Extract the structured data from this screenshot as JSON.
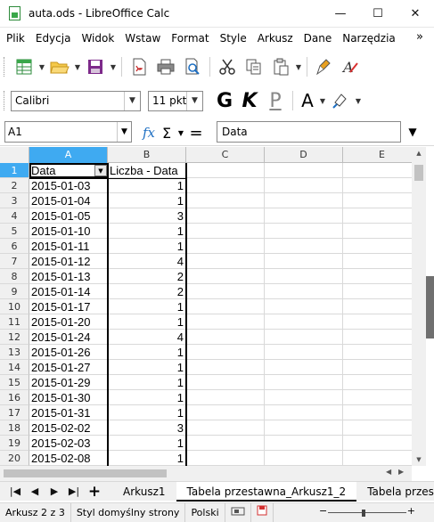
{
  "window": {
    "title": "auta.ods - LibreOffice Calc",
    "minimize": "—",
    "maximize": "☐",
    "close": "✕"
  },
  "menu": {
    "items": [
      "Plik",
      "Edycja",
      "Widok",
      "Wstaw",
      "Format",
      "Style",
      "Arkusz",
      "Dane",
      "Narzędzia"
    ],
    "more": "»"
  },
  "formatting": {
    "font_name": "Calibri",
    "font_size": "11 pkt",
    "bold": "G",
    "italic": "K",
    "underline": "P",
    "font_color": "A"
  },
  "formula_bar": {
    "name_box": "A1",
    "fx": "fx",
    "sum": "Σ",
    "equals": "=",
    "content": "Data"
  },
  "columns": [
    "A",
    "B",
    "C",
    "D",
    "E"
  ],
  "rows": [
    "1",
    "2",
    "3",
    "4",
    "5",
    "6",
    "7",
    "8",
    "9",
    "10",
    "11",
    "12",
    "13",
    "14",
    "15",
    "16",
    "17",
    "18",
    "19",
    "20"
  ],
  "sheet": {
    "header_a": "Data",
    "header_b": "Liczba - Data",
    "data": [
      {
        "date": "2015-01-03",
        "count": "1"
      },
      {
        "date": "2015-01-04",
        "count": "1"
      },
      {
        "date": "2015-01-05",
        "count": "3"
      },
      {
        "date": "2015-01-10",
        "count": "1"
      },
      {
        "date": "2015-01-11",
        "count": "1"
      },
      {
        "date": "2015-01-12",
        "count": "4"
      },
      {
        "date": "2015-01-13",
        "count": "2"
      },
      {
        "date": "2015-01-14",
        "count": "2"
      },
      {
        "date": "2015-01-17",
        "count": "1"
      },
      {
        "date": "2015-01-20",
        "count": "1"
      },
      {
        "date": "2015-01-24",
        "count": "4"
      },
      {
        "date": "2015-01-26",
        "count": "1"
      },
      {
        "date": "2015-01-27",
        "count": "1"
      },
      {
        "date": "2015-01-29",
        "count": "1"
      },
      {
        "date": "2015-01-30",
        "count": "1"
      },
      {
        "date": "2015-01-31",
        "count": "1"
      },
      {
        "date": "2015-02-02",
        "count": "3"
      },
      {
        "date": "2015-02-03",
        "count": "1"
      },
      {
        "date": "2015-02-08",
        "count": "1"
      }
    ]
  },
  "tabs": [
    "Arkusz1",
    "Tabela przestawna_Arkusz1_2",
    "Tabela przes"
  ],
  "status": {
    "sheet": "Arkusz 2 z 3",
    "page_style": "Styl domyślny strony",
    "language": "Polski",
    "zoom_minus": "−",
    "zoom_plus": "+",
    "zoom_level": 0.45
  },
  "colors": {
    "selection": "#3faaf1",
    "calc_green": "#3aa74a"
  }
}
